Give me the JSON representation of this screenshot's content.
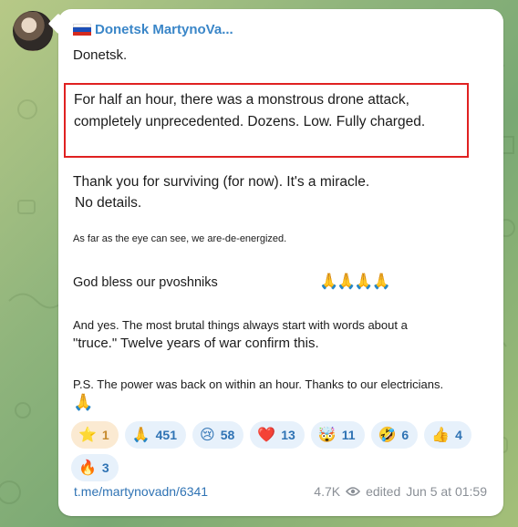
{
  "channel": {
    "name": "Donetsk MartynoVa...",
    "avatar": "avatar-photo"
  },
  "post": {
    "line1": "Donetsk.",
    "highlight": "For half an hour, there was a monstrous drone attack, completely unprecedented. Dozens. Low. Fully charged.",
    "line3a": "Thank you for surviving (for now). It's a miracle.",
    "line3b": "No details.",
    "line4": "As far as the eye can see, we are-de-energized.",
    "line5": "God bless our pvoshniks",
    "line5_emoji": "🙏🙏🙏🙏",
    "line6a": "And yes. The most brutal things always start with words about a",
    "line6b": "\"truce.\" Twelve years of war confirm this.",
    "line7": "P.S. The power was back on within an hour. Thanks to our electricians.",
    "line7_emoji": "🙏"
  },
  "reactions": [
    {
      "emoji": "⭐",
      "count": "1",
      "style": "star"
    },
    {
      "emoji": "🙏",
      "count": "451"
    },
    {
      "emoji": "😢",
      "count": "58"
    },
    {
      "emoji": "❤️",
      "count": "13"
    },
    {
      "emoji": "🤯",
      "count": "11"
    },
    {
      "emoji": "🤣",
      "count": "6"
    },
    {
      "emoji": "👍",
      "count": "4"
    },
    {
      "emoji": "🔥",
      "count": "3"
    }
  ],
  "footer": {
    "link": "t.me/martynovadn/6341",
    "views": "4.7K",
    "edited": "edited",
    "time": "Jun 5 at 01:59"
  },
  "colors": {
    "link": "#2f73b4",
    "sender": "#3a86c8",
    "highlight_border": "#e02121"
  }
}
